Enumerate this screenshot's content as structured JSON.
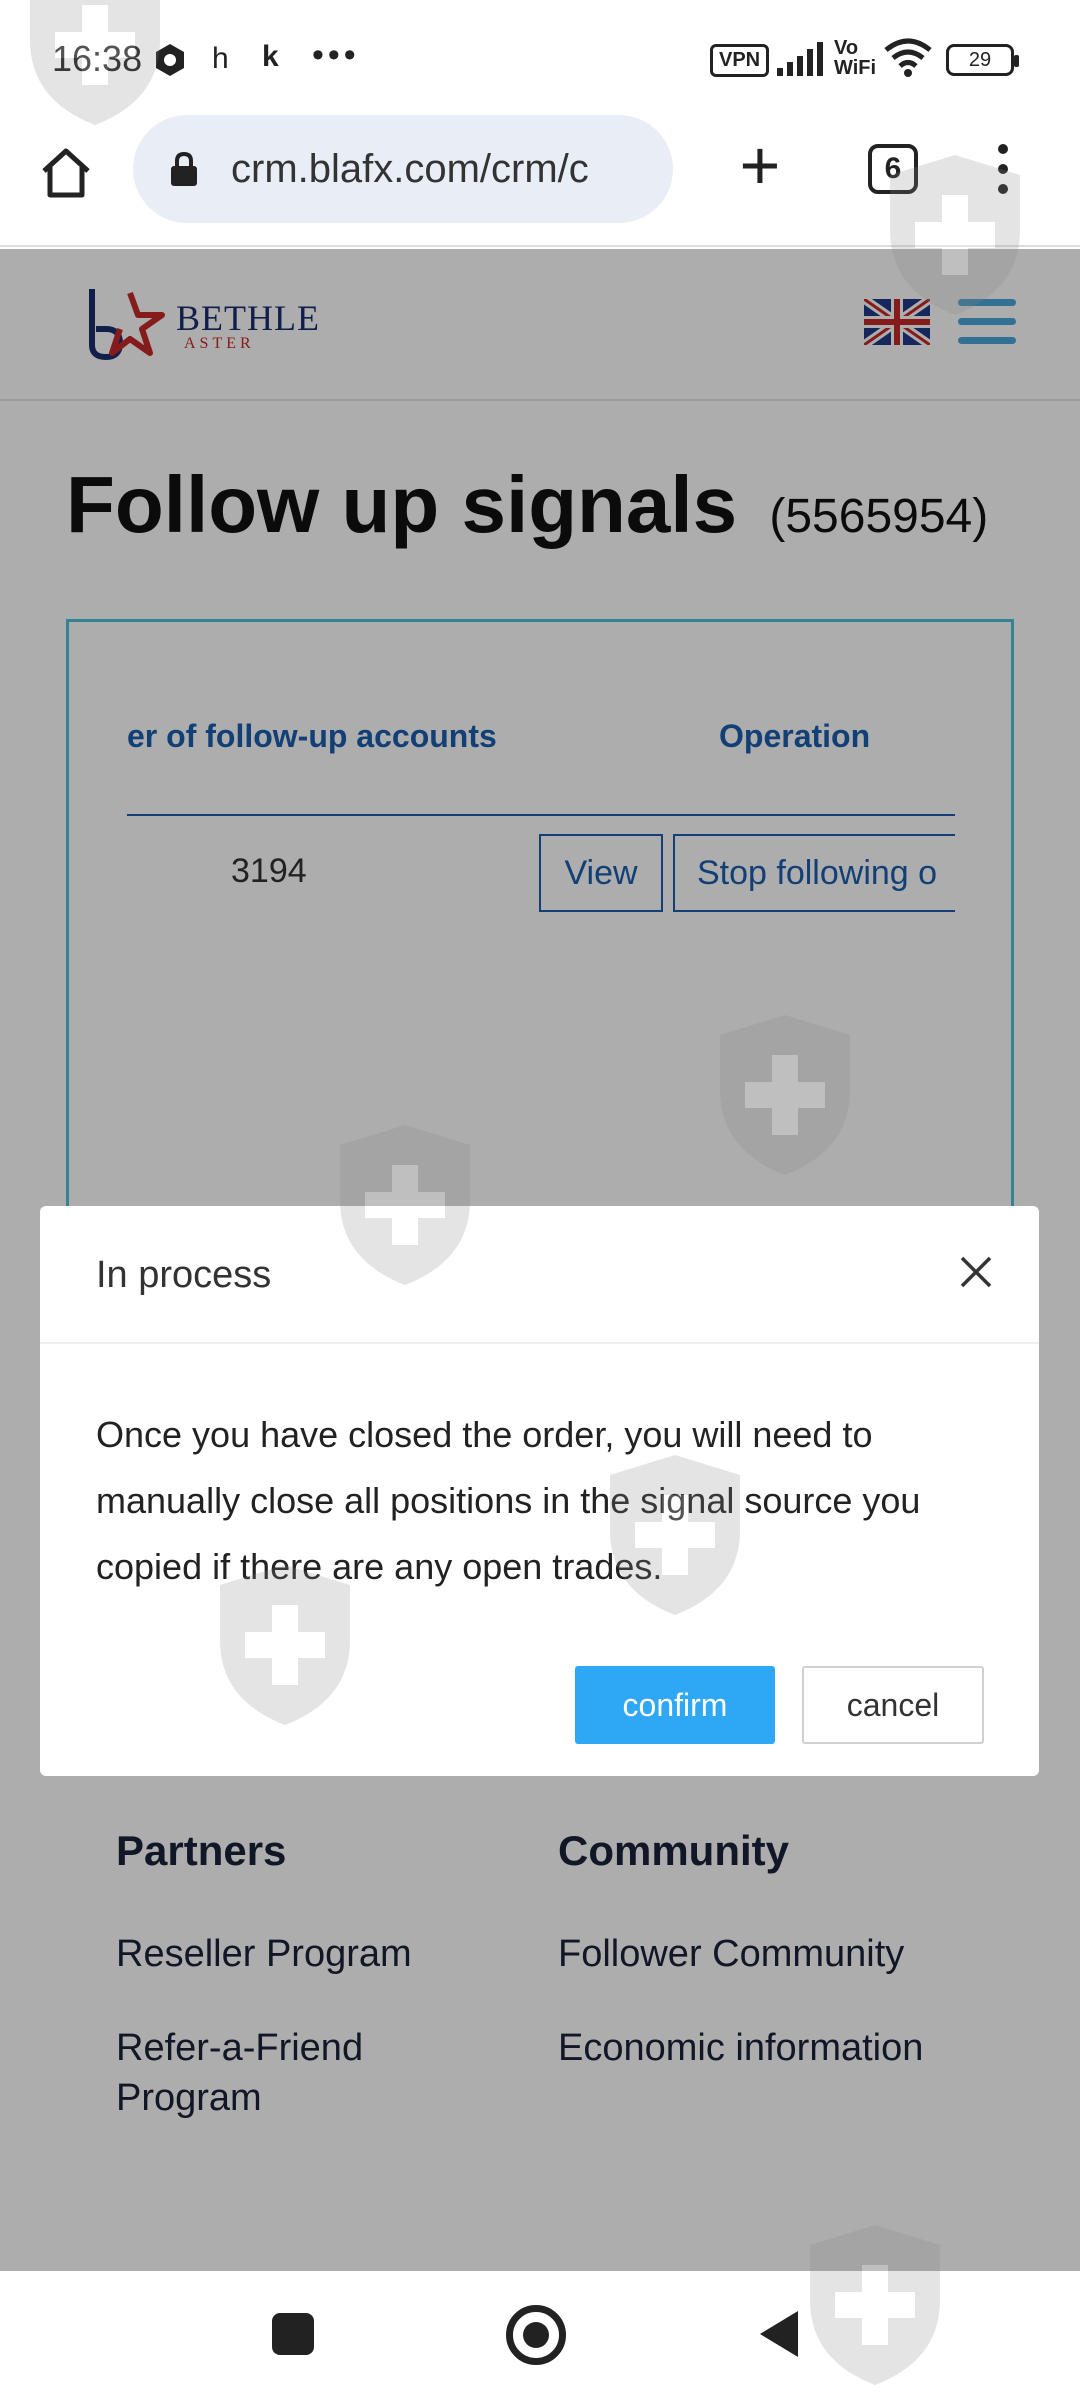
{
  "status_bar": {
    "time": "16:38",
    "notif_h": "h",
    "notif_k": "k",
    "more": "•••",
    "vpn": "VPN",
    "vowifi": "Vo\nWiFi",
    "battery": "29"
  },
  "browser": {
    "url": "crm.blafx.com/crm/c",
    "tab_count": "6"
  },
  "site": {
    "logo_name": "BETHLE",
    "logo_sub": "ASTER",
    "page_title": "Follow up signals",
    "page_title_id": "(5565954)"
  },
  "table": {
    "header_accounts": "er of follow-up accounts",
    "header_operation": "Operation",
    "row": {
      "count": "3194",
      "view_label": "View",
      "stop_label": "Stop following o"
    }
  },
  "footer": {
    "partners": {
      "heading": "Partners",
      "links": [
        "Reseller Program",
        "Refer-a-Friend Program"
      ]
    },
    "community": {
      "heading": "Community",
      "links": [
        "Follower Community",
        "Economic information"
      ]
    }
  },
  "modal": {
    "title": "In process",
    "body": "Once you have closed the order, you will need to manually close all positions in the signal source you copied if there are any open trades.",
    "confirm_label": "confirm",
    "cancel_label": "cancel"
  },
  "colors": {
    "accent_blue": "#2ea8f5",
    "table_border": "#4dc1d6",
    "link_blue": "#1b5fae"
  }
}
